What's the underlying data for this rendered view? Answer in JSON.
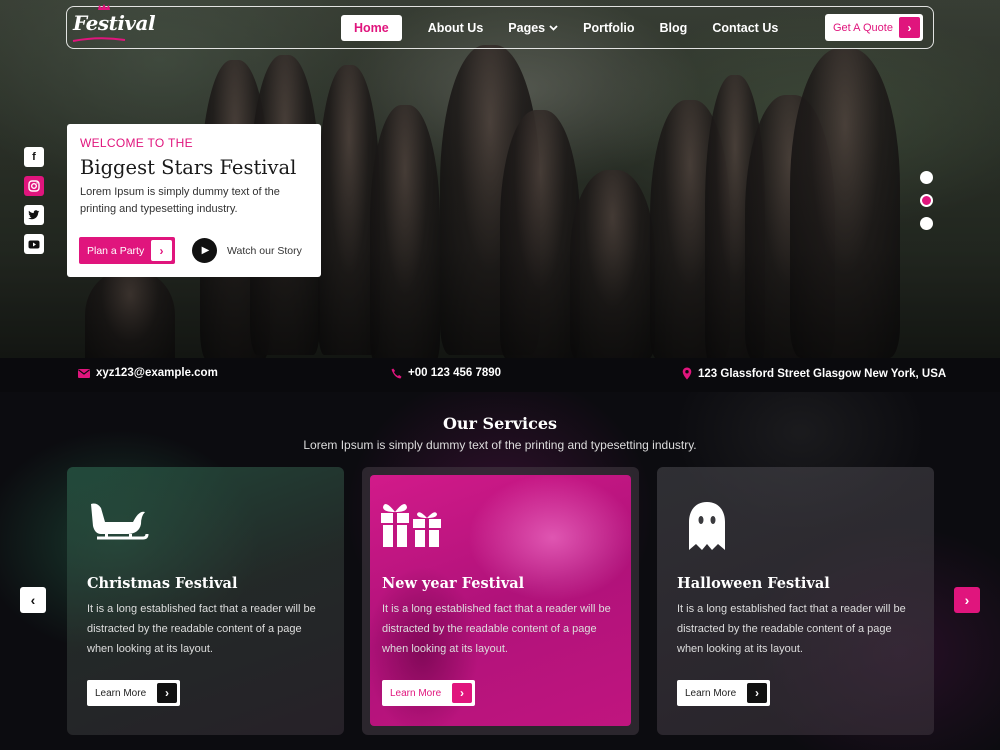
{
  "brand": {
    "logo_text": "Festival",
    "accent": "#e0157d"
  },
  "nav": {
    "items": [
      {
        "label": "Home",
        "active": true
      },
      {
        "label": "About Us"
      },
      {
        "label": "Pages",
        "has_dropdown": true
      },
      {
        "label": "Portfolio"
      },
      {
        "label": "Blog"
      },
      {
        "label": "Contact Us"
      }
    ],
    "quote_label": "Get A Quote"
  },
  "social": [
    "facebook-icon",
    "instagram-icon",
    "twitter-icon",
    "youtube-icon"
  ],
  "hero": {
    "eyebrow": "WELCOME TO THE",
    "title": "Biggest Stars Festival",
    "text": "Lorem Ipsum is simply dummy text of the printing and typesetting industry.",
    "party_label": "Plan a Party",
    "story_label": "Watch our Story",
    "slide_count": 3,
    "active_slide": 2
  },
  "contact": {
    "email": "xyz123@example.com",
    "phone": "+00 123 456 7890",
    "address": "123 Glassford Street Glasgow New York, USA"
  },
  "services": {
    "heading": "Our Services",
    "subheading": "Lorem Ipsum is simply dummy text of the printing and typesetting industry.",
    "cards": [
      {
        "icon": "sleigh-icon",
        "title": "Christmas Festival",
        "text": "It is a long established fact that a reader will be distracted by the readable content of a page when looking at its layout.",
        "button": "Learn More"
      },
      {
        "icon": "gift-icon",
        "title": "New year Festival",
        "text": "It is a long established fact that a reader will be distracted by the readable content of a page when looking at its layout.",
        "button": "Learn More",
        "featured": true
      },
      {
        "icon": "ghost-icon",
        "title": "Halloween Festival",
        "text": "It is a long established fact that a reader will be distracted by the readable content of a page when looking at its layout.",
        "button": "Learn More"
      }
    ]
  }
}
